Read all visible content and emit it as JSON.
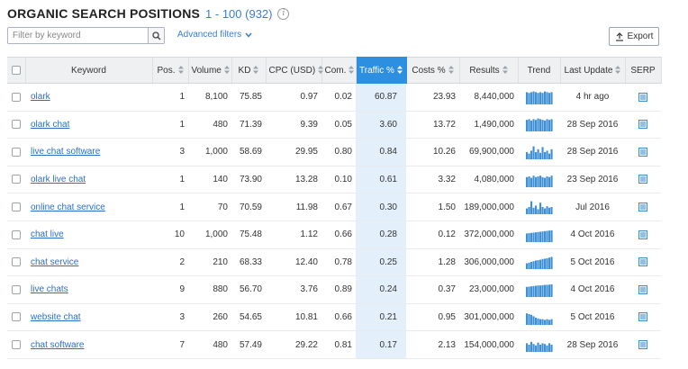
{
  "header": {
    "title": "ORGANIC SEARCH POSITIONS",
    "range": "1 - 100 (932)"
  },
  "toolbar": {
    "filter_placeholder": "Filter by keyword",
    "advanced_filters": "Advanced filters",
    "export_label": "Export"
  },
  "colors": {
    "accent": "#2d8fe0",
    "link": "#2a6fc9",
    "trend_bar": "#3d8fd6",
    "sorted_column_bg": "#e3effa"
  },
  "table": {
    "columns": [
      {
        "key": "checkbox",
        "label": ""
      },
      {
        "key": "keyword",
        "label": "Keyword"
      },
      {
        "key": "pos",
        "label": "Pos."
      },
      {
        "key": "volume",
        "label": "Volume"
      },
      {
        "key": "kd",
        "label": "KD"
      },
      {
        "key": "cpc",
        "label": "CPC (USD)"
      },
      {
        "key": "com",
        "label": "Com."
      },
      {
        "key": "traffic",
        "label": "Traffic %"
      },
      {
        "key": "costs",
        "label": "Costs %"
      },
      {
        "key": "results",
        "label": "Results"
      },
      {
        "key": "trend",
        "label": "Trend"
      },
      {
        "key": "last_update",
        "label": "Last Update"
      },
      {
        "key": "serp",
        "label": "SERP"
      }
    ],
    "sorted_column": "traffic",
    "rows": [
      {
        "keyword": "olark",
        "pos": "1",
        "volume": "8,100",
        "kd": "75.85",
        "cpc": "0.97",
        "com": "0.02",
        "traffic": "60.87",
        "costs": "23.93",
        "results": "8,440,000",
        "last_update": "4 hr ago",
        "trend": [
          0.85,
          0.8,
          0.85,
          0.9,
          0.85,
          0.8,
          0.85,
          0.8,
          0.9,
          0.85,
          0.8,
          0.85
        ]
      },
      {
        "keyword": "olark chat",
        "pos": "1",
        "volume": "480",
        "kd": "71.39",
        "cpc": "9.39",
        "com": "0.05",
        "traffic": "3.60",
        "costs": "13.72",
        "results": "1,490,000",
        "last_update": "28 Sep 2016",
        "trend": [
          0.8,
          0.85,
          0.75,
          0.85,
          0.8,
          0.9,
          0.85,
          0.8,
          0.75,
          0.85,
          0.8,
          0.85
        ]
      },
      {
        "keyword": "live chat software",
        "pos": "3",
        "volume": "1,000",
        "kd": "58.69",
        "cpc": "29.95",
        "com": "0.80",
        "traffic": "0.84",
        "costs": "10.26",
        "results": "69,900,000",
        "last_update": "28 Sep 2016",
        "trend": [
          0.5,
          0.4,
          0.6,
          0.9,
          0.5,
          0.7,
          0.45,
          0.85,
          0.5,
          0.6,
          0.4,
          0.7
        ]
      },
      {
        "keyword": "olark live chat",
        "pos": "1",
        "volume": "140",
        "kd": "73.90",
        "cpc": "13.28",
        "com": "0.10",
        "traffic": "0.61",
        "costs": "3.32",
        "results": "4,080,000",
        "last_update": "23 Sep 2016",
        "trend": [
          0.7,
          0.75,
          0.65,
          0.8,
          0.7,
          0.75,
          0.8,
          0.7,
          0.65,
          0.75,
          0.7,
          0.8
        ]
      },
      {
        "keyword": "online chat service",
        "pos": "1",
        "volume": "70",
        "kd": "70.59",
        "cpc": "11.98",
        "com": "0.67",
        "traffic": "0.30",
        "costs": "1.50",
        "results": "189,000,000",
        "last_update": "Jul 2016",
        "trend": [
          0.4,
          0.5,
          0.9,
          0.45,
          0.6,
          0.35,
          0.8,
          0.5,
          0.4,
          0.55,
          0.45,
          0.5
        ]
      },
      {
        "keyword": "chat live",
        "pos": "10",
        "volume": "1,000",
        "kd": "75.48",
        "cpc": "1.12",
        "com": "0.66",
        "traffic": "0.28",
        "costs": "0.12",
        "results": "372,000,000",
        "last_update": "4 Oct 2016",
        "trend": [
          0.6,
          0.62,
          0.64,
          0.66,
          0.68,
          0.7,
          0.72,
          0.74,
          0.76,
          0.78,
          0.8,
          0.82
        ]
      },
      {
        "keyword": "chat service",
        "pos": "2",
        "volume": "210",
        "kd": "68.33",
        "cpc": "12.40",
        "com": "0.78",
        "traffic": "0.25",
        "costs": "1.28",
        "results": "306,000,000",
        "last_update": "5 Oct 2016",
        "trend": [
          0.4,
          0.45,
          0.5,
          0.55,
          0.6,
          0.62,
          0.65,
          0.7,
          0.72,
          0.75,
          0.8,
          0.85
        ]
      },
      {
        "keyword": "live chats",
        "pos": "9",
        "volume": "880",
        "kd": "56.70",
        "cpc": "3.76",
        "com": "0.89",
        "traffic": "0.24",
        "costs": "0.37",
        "results": "23,000,000",
        "last_update": "4 Oct 2016",
        "trend": [
          0.7,
          0.72,
          0.74,
          0.76,
          0.78,
          0.8,
          0.8,
          0.82,
          0.84,
          0.85,
          0.86,
          0.88
        ]
      },
      {
        "keyword": "website chat",
        "pos": "3",
        "volume": "260",
        "kd": "54.65",
        "cpc": "10.81",
        "com": "0.66",
        "traffic": "0.21",
        "costs": "0.95",
        "results": "301,000,000",
        "last_update": "5 Oct 2016",
        "trend": [
          0.8,
          0.75,
          0.7,
          0.6,
          0.5,
          0.45,
          0.4,
          0.4,
          0.35,
          0.4,
          0.35,
          0.4
        ]
      },
      {
        "keyword": "chat software",
        "pos": "7",
        "volume": "480",
        "kd": "57.49",
        "cpc": "29.22",
        "com": "0.81",
        "traffic": "0.17",
        "costs": "2.13",
        "results": "154,000,000",
        "last_update": "28 Sep 2016",
        "trend": [
          0.6,
          0.5,
          0.7,
          0.55,
          0.45,
          0.65,
          0.5,
          0.6,
          0.55,
          0.45,
          0.6,
          0.5
        ]
      }
    ]
  }
}
